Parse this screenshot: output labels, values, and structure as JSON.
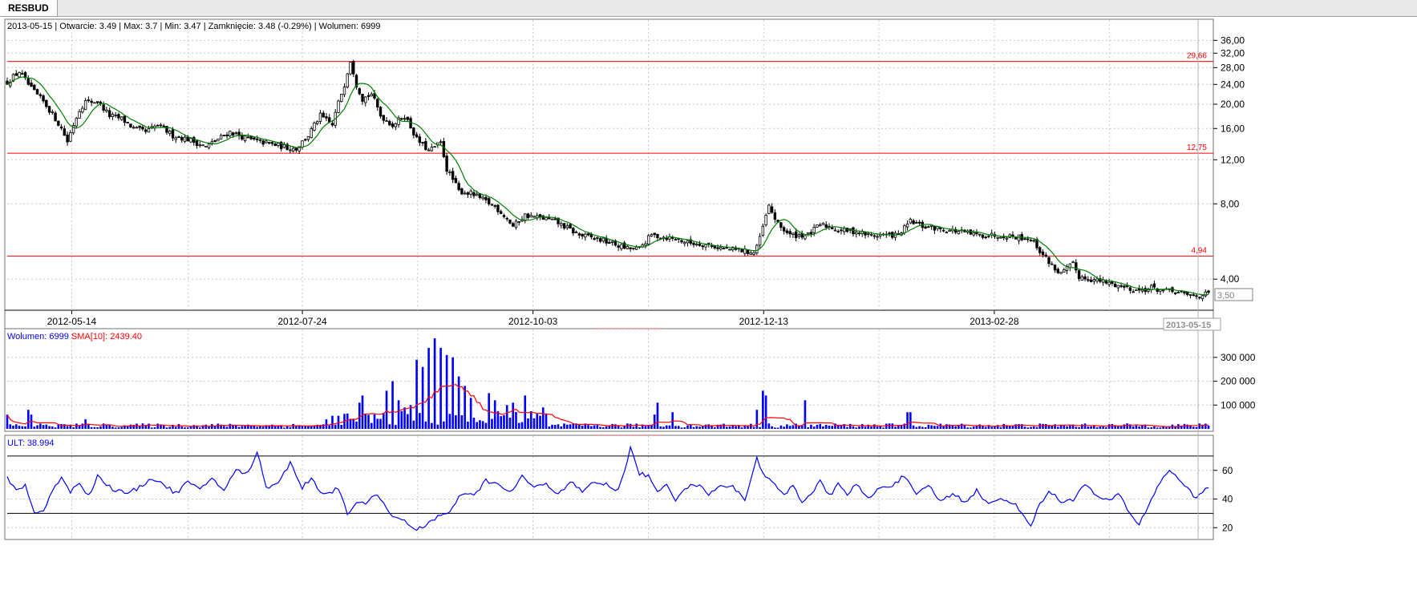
{
  "tab": {
    "label": "RESBUD"
  },
  "info": {
    "date": "2013-05-15",
    "open_label": "Otwarcie:",
    "open": "3.49",
    "max_label": "Max:",
    "max": "3.7",
    "min_label": "Min:",
    "min": "3.47",
    "close_label": "Zamknięcie:",
    "close": "3.48 (-0.29%)",
    "volume_label": "Wolumen:",
    "volume": "6999"
  },
  "volume_panel": {
    "label": "Wolumen: 6999",
    "sma_label": "SMA[10]: 2439.40"
  },
  "ult_panel": {
    "label": "ULT: 38.994"
  },
  "colors": {
    "up": "#ffffff",
    "down": "#000000",
    "candle_border": "#000000",
    "ma": "#008000",
    "hline": "#ff0000",
    "volume": "#0000ff",
    "sma": "#ff0000",
    "ult": "#0000ff",
    "grid": "#c8c8c8"
  },
  "chart_data": [
    {
      "type": "candlestick",
      "scale": "log",
      "ylim": [
        3.05,
        38
      ],
      "y_ticks": [
        "36,00",
        "32,00",
        "28,00",
        "24,00",
        "20,00",
        "16,00",
        "12,00",
        "8,00",
        "4,00"
      ],
      "x_tick_labels": [
        "2012-05-14",
        "2012-07-24",
        "2012-10-03",
        "2012-12-13",
        "2013-02-28"
      ],
      "last_date": "2013-05-15",
      "last_price_label": "3,50",
      "horizontal_lines": [
        {
          "value": 29.66,
          "label": "29,66"
        },
        {
          "value": 12.75,
          "label": "12,75"
        },
        {
          "value": 4.94,
          "label": "4,94"
        }
      ],
      "close_anchors": [
        [
          0,
          24.5
        ],
        [
          4,
          27
        ],
        [
          8,
          23
        ],
        [
          12,
          20.5
        ],
        [
          18,
          16
        ],
        [
          20,
          14.2
        ],
        [
          24,
          19
        ],
        [
          26,
          20.5
        ],
        [
          30,
          20.5
        ],
        [
          34,
          18
        ],
        [
          38,
          17.5
        ],
        [
          42,
          16
        ],
        [
          46,
          15.5
        ],
        [
          50,
          16.5
        ],
        [
          55,
          15
        ],
        [
          60,
          14.5
        ],
        [
          66,
          13.5
        ],
        [
          70,
          14.5
        ],
        [
          74,
          15.5
        ],
        [
          80,
          14.5
        ],
        [
          86,
          14
        ],
        [
          92,
          13.5
        ],
        [
          96,
          13.3
        ],
        [
          100,
          15
        ],
        [
          104,
          18
        ],
        [
          108,
          16.5
        ],
        [
          112,
          24
        ],
        [
          114,
          30
        ],
        [
          116,
          24
        ],
        [
          118,
          21
        ],
        [
          121,
          22
        ],
        [
          124,
          18
        ],
        [
          128,
          16.5
        ],
        [
          132,
          18
        ],
        [
          136,
          14.5
        ],
        [
          140,
          13
        ],
        [
          144,
          14
        ],
        [
          146,
          11
        ],
        [
          150,
          9
        ],
        [
          154,
          8.8
        ],
        [
          158,
          8.3
        ],
        [
          162,
          7.8
        ],
        [
          166,
          7
        ],
        [
          168,
          6.5
        ],
        [
          172,
          7.2
        ],
        [
          178,
          7
        ],
        [
          182,
          6.8
        ],
        [
          186,
          6.4
        ],
        [
          190,
          6
        ],
        [
          196,
          5.8
        ],
        [
          200,
          5.6
        ],
        [
          206,
          5.3
        ],
        [
          210,
          5.3
        ],
        [
          214,
          6
        ],
        [
          218,
          5.9
        ],
        [
          222,
          5.8
        ],
        [
          226,
          5.6
        ],
        [
          232,
          5.5
        ],
        [
          238,
          5.3
        ],
        [
          244,
          5.2
        ],
        [
          248,
          5.1
        ],
        [
          250,
          5.8
        ],
        [
          253,
          7.8
        ],
        [
          256,
          6.6
        ],
        [
          260,
          6
        ],
        [
          266,
          6
        ],
        [
          270,
          6.6
        ],
        [
          273,
          6.5
        ],
        [
          276,
          6.3
        ],
        [
          282,
          6.2
        ],
        [
          286,
          6
        ],
        [
          292,
          6
        ],
        [
          296,
          6
        ],
        [
          300,
          6.8
        ],
        [
          304,
          6.5
        ],
        [
          308,
          6.4
        ],
        [
          312,
          6.3
        ],
        [
          316,
          6.2
        ],
        [
          322,
          6
        ],
        [
          326,
          6
        ],
        [
          330,
          6
        ],
        [
          336,
          5.9
        ],
        [
          340,
          5.8
        ],
        [
          344,
          5
        ],
        [
          348,
          4.4
        ],
        [
          350,
          4.2
        ],
        [
          354,
          4.6
        ],
        [
          356,
          4.1
        ],
        [
          360,
          4
        ],
        [
          364,
          3.9
        ],
        [
          368,
          3.8
        ],
        [
          372,
          3.7
        ],
        [
          376,
          3.6
        ],
        [
          380,
          3.7
        ],
        [
          384,
          3.6
        ],
        [
          388,
          3.55
        ],
        [
          392,
          3.45
        ],
        [
          396,
          3.45
        ],
        [
          398,
          3.48
        ]
      ],
      "volume_ylim": [
        0,
        370000
      ],
      "volume_ticks": [
        "300 000",
        "200 000",
        "100 000"
      ],
      "volume_spikes": [
        [
          0,
          60000
        ],
        [
          7,
          80000
        ],
        [
          8,
          60000
        ],
        [
          26,
          40000
        ],
        [
          106,
          40000
        ],
        [
          108,
          55000
        ],
        [
          110,
          55000
        ],
        [
          117,
          110000
        ],
        [
          118,
          140000
        ],
        [
          126,
          160000
        ],
        [
          128,
          200000
        ],
        [
          130,
          120000
        ],
        [
          132,
          90000
        ],
        [
          134,
          100000
        ],
        [
          136,
          290000
        ],
        [
          138,
          260000
        ],
        [
          140,
          340000
        ],
        [
          142,
          380000
        ],
        [
          144,
          340000
        ],
        [
          146,
          310000
        ],
        [
          148,
          300000
        ],
        [
          150,
          220000
        ],
        [
          152,
          180000
        ],
        [
          154,
          130000
        ],
        [
          160,
          150000
        ],
        [
          162,
          120000
        ],
        [
          166,
          100000
        ],
        [
          168,
          110000
        ],
        [
          172,
          140000
        ],
        [
          178,
          90000
        ],
        [
          215,
          60000
        ],
        [
          216,
          110000
        ],
        [
          221,
          70000
        ],
        [
          249,
          80000
        ],
        [
          251,
          160000
        ],
        [
          252,
          140000
        ],
        [
          265,
          120000
        ],
        [
          299,
          70000
        ],
        [
          300,
          70000
        ]
      ],
      "ult_ylim": [
        14,
        80
      ],
      "ult_ticks": [
        "60",
        "40",
        "20"
      ],
      "ult_bands": [
        30,
        70
      ],
      "ult_anchors": [
        [
          0,
          55
        ],
        [
          3,
          46
        ],
        [
          6,
          50
        ],
        [
          9,
          30
        ],
        [
          12,
          32
        ],
        [
          15,
          45
        ],
        [
          18,
          56
        ],
        [
          21,
          45
        ],
        [
          24,
          52
        ],
        [
          27,
          42
        ],
        [
          30,
          56
        ],
        [
          33,
          50
        ],
        [
          36,
          46
        ],
        [
          40,
          44
        ],
        [
          44,
          48
        ],
        [
          48,
          55
        ],
        [
          52,
          50
        ],
        [
          56,
          44
        ],
        [
          60,
          52
        ],
        [
          64,
          46
        ],
        [
          68,
          55
        ],
        [
          72,
          46
        ],
        [
          76,
          60
        ],
        [
          80,
          58
        ],
        [
          83,
          73
        ],
        [
          86,
          48
        ],
        [
          90,
          52
        ],
        [
          94,
          65
        ],
        [
          98,
          48
        ],
        [
          101,
          55
        ],
        [
          104,
          45
        ],
        [
          107,
          44
        ],
        [
          110,
          48
        ],
        [
          113,
          30
        ],
        [
          116,
          38
        ],
        [
          119,
          36
        ],
        [
          123,
          44
        ],
        [
          127,
          30
        ],
        [
          131,
          26
        ],
        [
          135,
          18
        ],
        [
          139,
          22
        ],
        [
          143,
          28
        ],
        [
          147,
          30
        ],
        [
          151,
          44
        ],
        [
          155,
          42
        ],
        [
          159,
          53
        ],
        [
          163,
          50
        ],
        [
          167,
          44
        ],
        [
          171,
          56
        ],
        [
          175,
          48
        ],
        [
          179,
          50
        ],
        [
          183,
          44
        ],
        [
          187,
          52
        ],
        [
          191,
          45
        ],
        [
          195,
          52
        ],
        [
          199,
          50
        ],
        [
          203,
          46
        ],
        [
          207,
          75
        ],
        [
          210,
          58
        ],
        [
          213,
          56
        ],
        [
          216,
          44
        ],
        [
          219,
          50
        ],
        [
          222,
          40
        ],
        [
          225,
          48
        ],
        [
          229,
          50
        ],
        [
          233,
          44
        ],
        [
          237,
          50
        ],
        [
          241,
          48
        ],
        [
          245,
          40
        ],
        [
          249,
          68
        ],
        [
          252,
          55
        ],
        [
          255,
          50
        ],
        [
          258,
          42
        ],
        [
          261,
          50
        ],
        [
          264,
          38
        ],
        [
          267,
          44
        ],
        [
          270,
          52
        ],
        [
          273,
          42
        ],
        [
          276,
          50
        ],
        [
          279,
          44
        ],
        [
          282,
          50
        ],
        [
          286,
          40
        ],
        [
          290,
          48
        ],
        [
          294,
          50
        ],
        [
          298,
          56
        ],
        [
          302,
          42
        ],
        [
          306,
          50
        ],
        [
          310,
          38
        ],
        [
          314,
          44
        ],
        [
          318,
          38
        ],
        [
          322,
          46
        ],
        [
          326,
          36
        ],
        [
          330,
          40
        ],
        [
          334,
          38
        ],
        [
          337,
          30
        ],
        [
          340,
          22
        ],
        [
          343,
          36
        ],
        [
          346,
          46
        ],
        [
          350,
          38
        ],
        [
          354,
          40
        ],
        [
          358,
          50
        ],
        [
          362,
          42
        ],
        [
          366,
          38
        ],
        [
          369,
          44
        ],
        [
          373,
          30
        ],
        [
          376,
          22
        ],
        [
          380,
          40
        ],
        [
          383,
          52
        ],
        [
          386,
          60
        ],
        [
          389,
          55
        ],
        [
          392,
          47
        ],
        [
          395,
          40
        ],
        [
          398,
          48
        ]
      ]
    }
  ]
}
